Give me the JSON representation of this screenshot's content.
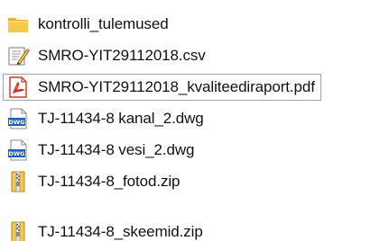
{
  "files": [
    {
      "name": "kontrolli_tulemused",
      "icon": "folder-icon",
      "type": "folder"
    },
    {
      "name": "SMRO-YIT29112018.csv",
      "icon": "csv-file-icon",
      "type": "csv"
    },
    {
      "name": "SMRO-YIT29112018_kvaliteediraport.pdf",
      "icon": "pdf-file-icon",
      "type": "pdf",
      "selected": true
    },
    {
      "name": "TJ-11434-8 kanal_2.dwg",
      "icon": "dwg-file-icon",
      "type": "dwg"
    },
    {
      "name": "TJ-11434-8 vesi_2.dwg",
      "icon": "dwg-file-icon",
      "type": "dwg"
    },
    {
      "name": "TJ-11434-8_fotod.zip",
      "icon": "zip-file-icon",
      "type": "zip"
    },
    {
      "name": "TJ-11434-8_skeemid.zip",
      "icon": "zip-file-icon",
      "type": "zip"
    }
  ],
  "colors": {
    "folder": "#f5c343",
    "pdf_accent": "#d93025",
    "dwg_accent": "#1f5fbf",
    "zip_accent": "#e0a92a",
    "selection_border": "#9aa6b4"
  }
}
